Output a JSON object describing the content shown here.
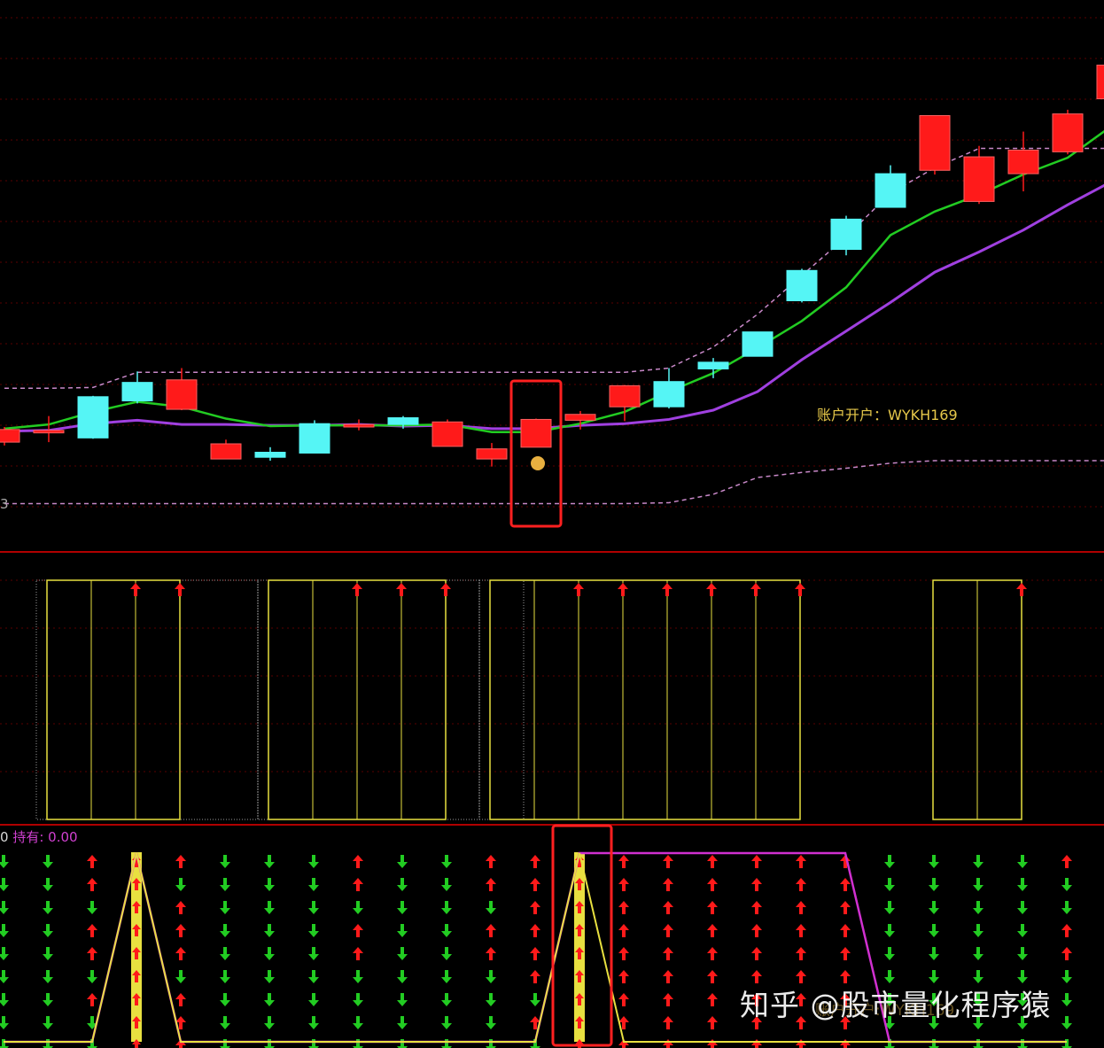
{
  "colors": {
    "background": "#000000",
    "up": "#ff1a1a",
    "down": "#55f5f5",
    "ma_short": "#22cc22",
    "ma_long": "#a040e0",
    "band": "#c888c8",
    "grid": "#5a0000",
    "divider": "#b00000",
    "signal_box": "#e8e040",
    "hold_line": "#d030d0",
    "buy_line": "#e8e040",
    "arrow_up": "#ff1a1a",
    "arrow_down": "#22cc22",
    "highlight": "#ff2020"
  },
  "labels": {
    "account": "账户开户：WYKH169",
    "hold_zero": "0",
    "hold_text": "持有: 0.00",
    "price_tick": "3",
    "watermark": "知乎 @股市量化程序猿",
    "watermark_under": "账户开户:WYKH169"
  },
  "chart_data": [
    {
      "type": "candlestick",
      "title": "",
      "candles": [
        {
          "o": 22,
          "c": 37,
          "h": 40,
          "l": 18
        },
        {
          "o": 33,
          "c": 36,
          "h": 53,
          "l": 22
        },
        {
          "o": 76,
          "c": 27,
          "h": 77,
          "l": 26
        },
        {
          "o": 93,
          "c": 71,
          "h": 106,
          "l": 68
        },
        {
          "o": 61,
          "c": 96,
          "h": 110,
          "l": 60
        },
        {
          "o": 2,
          "c": 20,
          "h": 25,
          "l": 2
        },
        {
          "o": 10,
          "c": 4,
          "h": 16,
          "l": 0
        },
        {
          "o": 44,
          "c": 9,
          "h": 48,
          "l": 9
        },
        {
          "o": 40,
          "c": 43,
          "h": 49,
          "l": 36
        },
        {
          "o": 51,
          "c": 43,
          "h": 53,
          "l": 38
        },
        {
          "o": 17,
          "c": 46,
          "h": 49,
          "l": 17
        },
        {
          "o": 2,
          "c": 14,
          "h": 21,
          "l": -7
        },
        {
          "o": 16,
          "c": 49,
          "h": 50,
          "l": 16
        },
        {
          "o": 48,
          "c": 55,
          "h": 59,
          "l": 37
        },
        {
          "o": 64,
          "c": 89,
          "h": 90,
          "l": 47
        },
        {
          "o": 94,
          "c": 64,
          "h": 110,
          "l": 62
        },
        {
          "o": 117,
          "c": 109,
          "h": 122,
          "l": 98
        },
        {
          "o": 153,
          "c": 124,
          "h": 153,
          "l": 124
        },
        {
          "o": 226,
          "c": 190,
          "h": 228,
          "l": 188
        },
        {
          "o": 287,
          "c": 251,
          "h": 291,
          "l": 244
        },
        {
          "o": 341,
          "c": 301,
          "h": 351,
          "l": 301
        },
        {
          "o": 345,
          "c": 410,
          "h": 410,
          "l": 340
        },
        {
          "o": 308,
          "c": 361,
          "h": 374,
          "l": 305
        },
        {
          "o": 341,
          "c": 369,
          "h": 391,
          "l": 320
        },
        {
          "o": 367,
          "c": 412,
          "h": 417,
          "l": 364
        },
        {
          "o": 430,
          "c": 470,
          "h": 486,
          "l": 424
        }
      ],
      "ma_short": [
        38,
        43,
        58,
        70,
        64,
        50,
        41,
        42,
        42,
        42,
        43,
        34,
        34,
        44,
        58,
        82,
        104,
        134,
        166,
        206,
        268,
        296,
        316,
        340,
        360,
        398
      ],
      "ma_long": [
        35,
        36,
        44,
        48,
        43,
        43,
        42,
        42,
        43,
        41,
        42,
        38,
        38,
        42,
        44,
        49,
        60,
        82,
        120,
        154,
        188,
        224,
        248,
        274,
        304,
        332
      ],
      "band_upper": [
        86,
        86,
        87,
        105,
        105,
        105,
        105,
        105,
        105,
        105,
        105,
        105,
        105,
        105,
        105,
        110,
        135,
        174,
        220,
        266,
        318,
        348,
        371,
        371,
        371,
        371
      ],
      "band_lower": [
        -51,
        -51,
        -51,
        -51,
        -51,
        -51,
        -51,
        -51,
        -51,
        -51,
        -51,
        -51,
        -51,
        -51,
        -51,
        -50,
        -40,
        -20,
        -14,
        -9,
        -3,
        0,
        0,
        0,
        0,
        0
      ],
      "highlight_candle": 12,
      "annotations": [
        "账户开户：WYKH169"
      ]
    },
    {
      "type": "signal_blocks",
      "blocks": [
        [
          1,
          3
        ],
        [
          6,
          9
        ],
        [
          11,
          17
        ],
        [
          21,
          22
        ]
      ],
      "dotted_blocks": [
        [
          0,
          5
        ],
        [
          5,
          10
        ],
        [
          10,
          11
        ]
      ],
      "arrows_up": [
        2,
        3,
        7,
        8,
        9,
        12,
        13,
        14,
        15,
        16,
        17,
        22
      ]
    },
    {
      "type": "arrow_matrix",
      "hold_label": "持有: 0.00",
      "hold_line": [
        0,
        0,
        0,
        1,
        0,
        0,
        0,
        0,
        0,
        0,
        0,
        0,
        0,
        1,
        1,
        1,
        1,
        1,
        1,
        1,
        0,
        0,
        0,
        0,
        0
      ],
      "buy_line": [
        0,
        0,
        0,
        1,
        0,
        0,
        0,
        0,
        0,
        0,
        0,
        0,
        0,
        1,
        0,
        0,
        0,
        0,
        0,
        0,
        0,
        0,
        0,
        0,
        0
      ],
      "yellow_bars": [
        3,
        13
      ],
      "highlight_column": 13,
      "columns": [
        {
          "arrows": "ddddddddd"
        },
        {
          "arrows": "ddddddddd"
        },
        {
          "arrows": "uuduududd"
        },
        {
          "arrows": "yyyyyyyyy"
        },
        {
          "arrows": "uduuuduuu"
        },
        {
          "arrows": "ddddddddd"
        },
        {
          "arrows": "ddddddddd"
        },
        {
          "arrows": "ddddddddd"
        },
        {
          "arrows": "uuduudddd"
        },
        {
          "arrows": "ddddddddd"
        },
        {
          "arrows": "ddddddddd"
        },
        {
          "arrows": "uuduudddd"
        },
        {
          "arrows": "uuuuuudud"
        },
        {
          "arrows": "yyyyyyyyy"
        },
        {
          "arrows": "uuuuuuuuu"
        },
        {
          "arrows": "uuuuuuuuu"
        },
        {
          "arrows": "uuuuuuuuu"
        },
        {
          "arrows": "uuuuuuuuu"
        },
        {
          "arrows": "uuuuuuuuu"
        },
        {
          "arrows": "uuuuuuuuu"
        },
        {
          "arrows": "ddddddddd"
        },
        {
          "arrows": "ddddddddd"
        },
        {
          "arrows": "ddddddddd"
        },
        {
          "arrows": "ddddddddd"
        },
        {
          "arrows": "udduudddd"
        }
      ]
    }
  ]
}
